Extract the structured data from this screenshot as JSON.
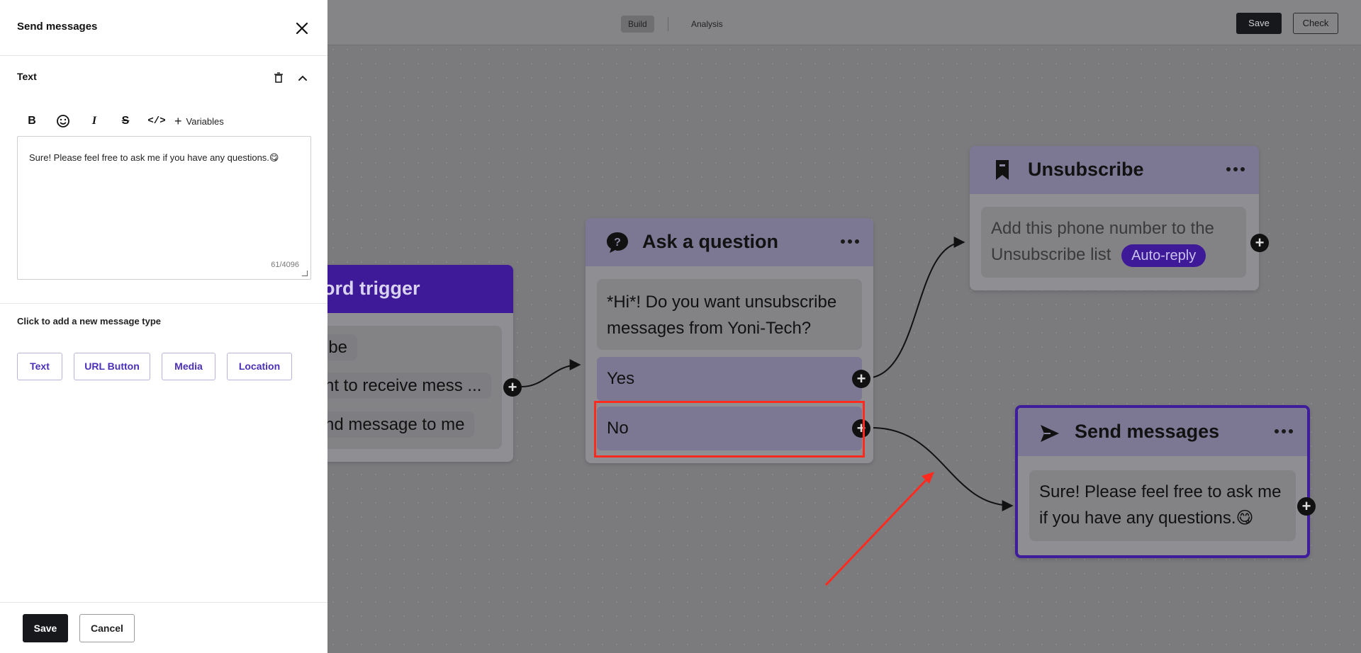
{
  "topbar": {
    "tabs": [
      {
        "label": "Build",
        "active": true
      },
      {
        "label": "Analysis",
        "active": false
      }
    ],
    "save_label": "Save",
    "check_label": "Check"
  },
  "nodes": {
    "trigger": {
      "title": "ord trigger",
      "items": [
        "ibe",
        "nt to receive mess ...",
        "nd message to me"
      ]
    },
    "question": {
      "title": "Ask a question",
      "icon": "question-bubble-icon",
      "message": "*Hi*! Do you want unsubscribe messages from Yoni-Tech?",
      "options": [
        "Yes",
        "No"
      ]
    },
    "unsubscribe": {
      "title": "Unsubscribe",
      "icon": "bookmark-icon",
      "text": "Add this phone number to the Unsubscribe list",
      "badge": "Auto-reply"
    },
    "send": {
      "title": "Send messages",
      "icon": "send-icon",
      "text": "Sure! Please feel free to ask me if you have any questions.😋"
    }
  },
  "panel": {
    "title": "Send messages",
    "section_label": "Text",
    "toolbar": {
      "bold": "B",
      "italic": "I",
      "strike": "S",
      "code": "</>",
      "variables": "Variables"
    },
    "editor_text": "Sure! Please feel free to ask me if you have any questions.😋",
    "char_count": "61/4096",
    "add_type_label": "Click to add a new message type",
    "types": [
      "Text",
      "URL Button",
      "Media",
      "Location"
    ],
    "save_label": "Save",
    "cancel_label": "Cancel"
  },
  "colors": {
    "accent": "#4b2fb8",
    "highlight": "#ff2a1f",
    "trigger_header": "#3e1a98",
    "send_border": "#3f1c9c"
  }
}
